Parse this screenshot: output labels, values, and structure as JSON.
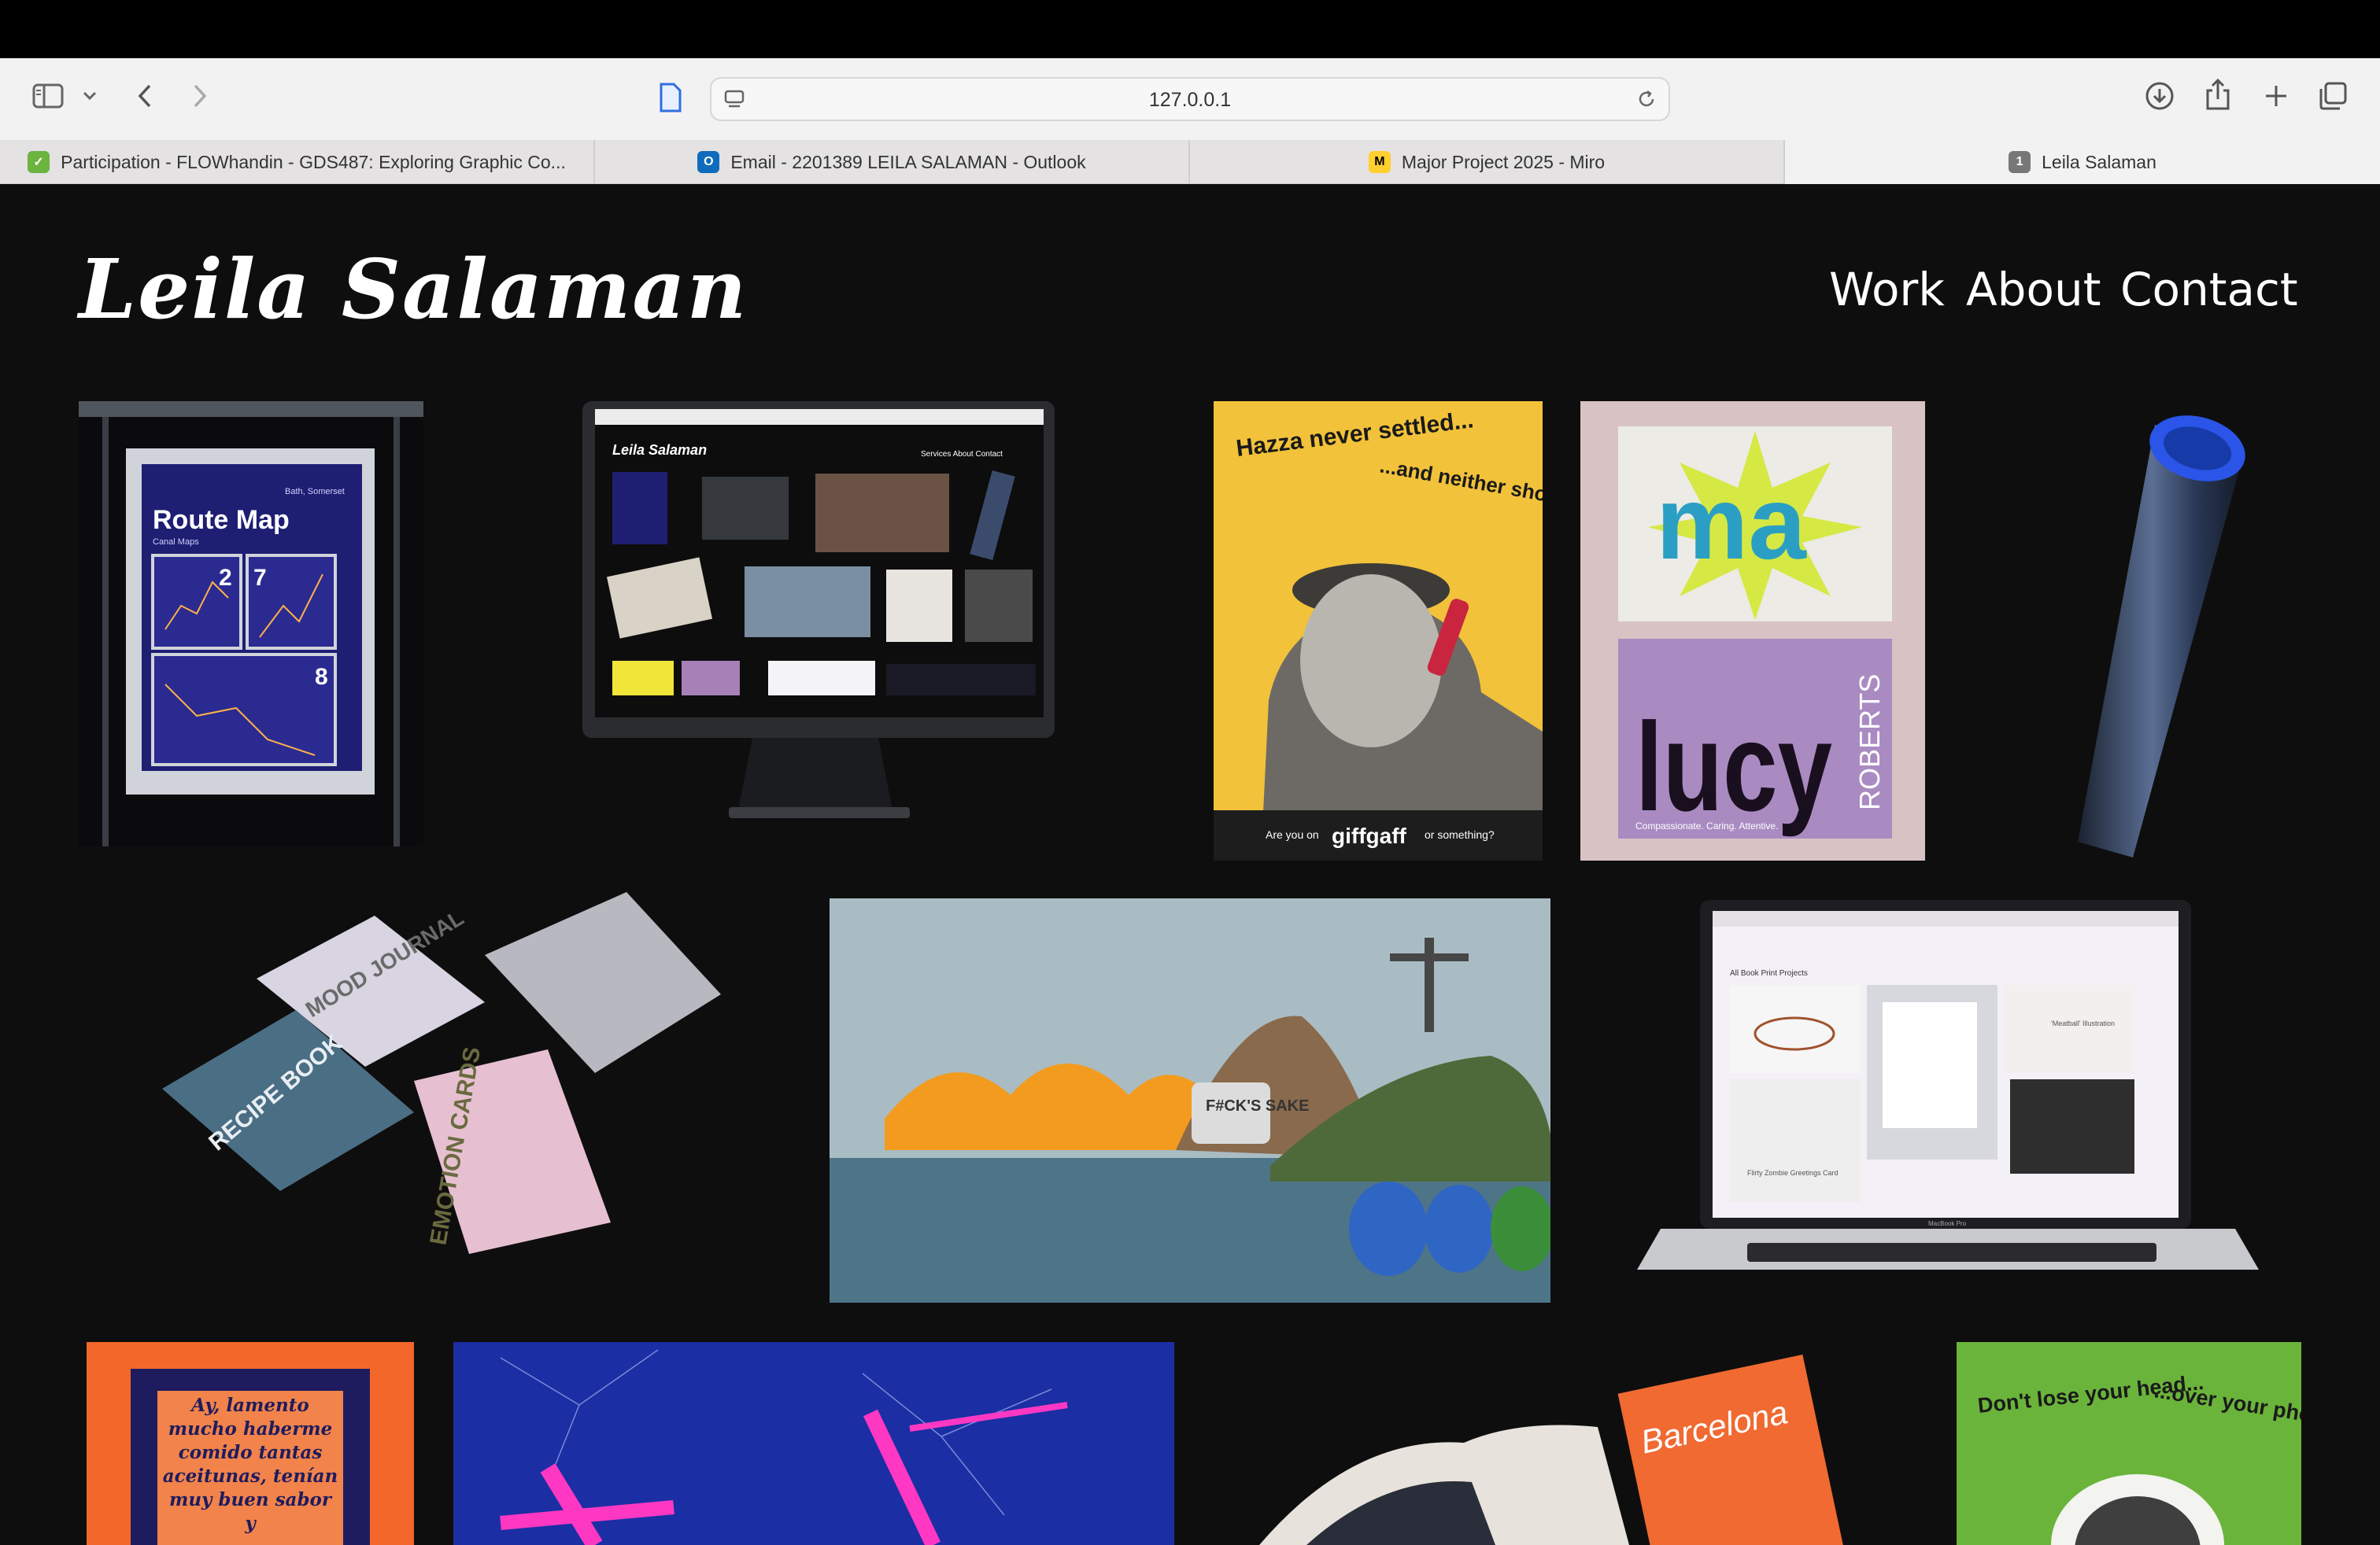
{
  "browser": {
    "url": "127.0.0.1",
    "tabs": [
      {
        "label": "Participation - FLOWhandin - GDS487: Exploring Graphic Co...",
        "favicon_color": "#6cb33f"
      },
      {
        "label": "Email - 2201389 LEILA SALAMAN - Outlook",
        "favicon_color": "#0f6cbd"
      },
      {
        "label": "Major Project 2025 - Miro",
        "favicon_color": "#ffd02f"
      },
      {
        "label": "Leila Salaman",
        "favicon_color": "#777777",
        "badge": "1"
      }
    ]
  },
  "site": {
    "logo": "Leila Salaman",
    "nav": [
      "Work",
      "About",
      "Contact"
    ]
  },
  "tiles": {
    "route_map": {
      "title": "Route Map",
      "subtitle": "Canal Maps",
      "location": "Bath, Somerset",
      "n1": "2",
      "n2": "7",
      "n3": "8"
    },
    "imac": {
      "site_logo": "Leila Salaman",
      "nav": "Services   About   Contact"
    },
    "poster_henry": {
      "left": "Hazza never settled...",
      "right": "...and neither should you",
      "footer_left": "Are you on",
      "brand": "giffgaff",
      "footer_right": "or something?"
    },
    "brand_cards": {
      "ma": "ma",
      "name": "lucy",
      "surname": "ROBERTS",
      "tagline": "Compassionate. Caring. Attentive."
    },
    "boxes": {
      "mood": "MOOD JOURNAL",
      "recipe": "RECIPE BOOK",
      "emotion": "EMOTION CARDS"
    },
    "collage": {
      "speech": "F#CK'S SAKE"
    },
    "laptop": {
      "tabs": "All   Book   Print   Projects",
      "card1": "'Meatball' Illustration",
      "card2": "Flirty Zombie Greetings Card",
      "model": "MacBook Pro"
    },
    "spanish": {
      "text": "Ay, lamento mucho haberme comido tantas aceitunas, tenían muy buen sabor y"
    },
    "barcelona": {
      "title": "Barcelona"
    },
    "poster_annie": {
      "left": "Don't lose your head...",
      "right": "...over your phone bill like Annie B"
    }
  }
}
